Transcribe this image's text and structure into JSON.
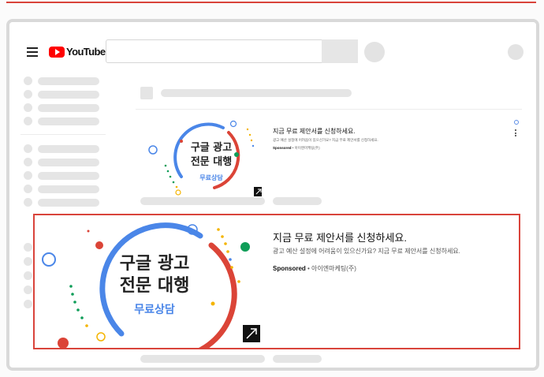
{
  "app": {
    "logo_text": "YouTube"
  },
  "ad_small": {
    "image_line1": "구글 광고",
    "image_line2": "전문 대행",
    "image_button": "무료상담",
    "title": "지금 무료 제안서를 신청하세요.",
    "description": "광고 예산 설정에 어려움이 있으신가요? 지금 무료 제안서를 신청하세요.",
    "sponsored_label": "Sponsored",
    "advertiser": " • 아이엔마케팅(주)"
  },
  "ad_big": {
    "image_line1": "구글 광고",
    "image_line2": "전문 대행",
    "image_button": "무료상담",
    "title": "지금 무료 제안서를 신청하세요.",
    "description": "광고 예산 설정에 어려움이 있으신가요? 지금 무료 제안서를 신청하세요.",
    "sponsored_label": "Sponsored",
    "advertiser": " • 아이엔마케팅(주)"
  },
  "colors": {
    "highlight": "#d9443b",
    "brand_red": "#ff0000",
    "ring_blue": "#4a86e8",
    "ring_red": "#db4437",
    "accent_green": "#0f9d58",
    "accent_yellow": "#f4b400"
  }
}
